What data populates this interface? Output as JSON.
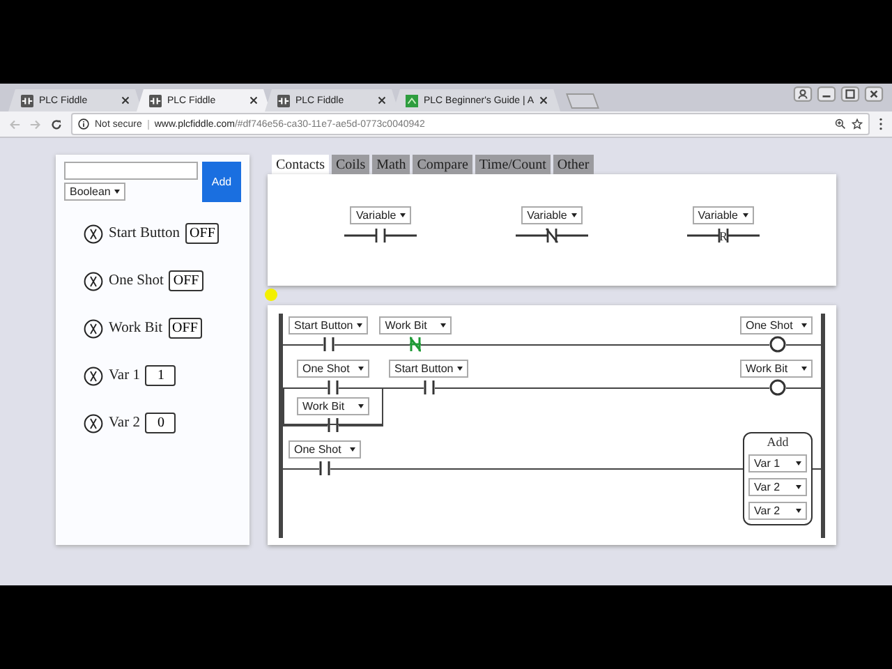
{
  "browser": {
    "tabs": [
      {
        "title": "PLC Fiddle",
        "selected": false,
        "kind": "fiddle"
      },
      {
        "title": "PLC Fiddle",
        "selected": true,
        "kind": "fiddle"
      },
      {
        "title": "PLC Fiddle",
        "selected": false,
        "kind": "fiddle"
      },
      {
        "title": "PLC Beginner's Guide | A",
        "selected": false,
        "kind": "guide"
      }
    ],
    "address_bar": {
      "security": "Not secure",
      "host": "www.plcfiddle.com",
      "path": "/#df746e56-ca30-11e7-ae5d-0773c0040942"
    }
  },
  "sidebar": {
    "type_dropdown": "Boolean",
    "add_button": "Add",
    "variables": [
      {
        "name": "Start Button",
        "value": "OFF"
      },
      {
        "name": "One Shot",
        "value": "OFF"
      },
      {
        "name": "Work Bit",
        "value": "OFF"
      },
      {
        "name": "Var 1",
        "value": "1"
      },
      {
        "name": "Var 2",
        "value": "0"
      }
    ]
  },
  "palette": {
    "tabs": [
      {
        "label": "Contacts",
        "selected": true
      },
      {
        "label": "Coils",
        "selected": false
      },
      {
        "label": "Math",
        "selected": false
      },
      {
        "label": "Compare",
        "selected": false
      },
      {
        "label": "Time/Count",
        "selected": false
      },
      {
        "label": "Other",
        "selected": false
      }
    ],
    "items": [
      {
        "variable": "Variable",
        "kind": "no"
      },
      {
        "variable": "Variable",
        "kind": "nc"
      },
      {
        "variable": "Variable",
        "kind": "rising",
        "symbol": "R"
      }
    ]
  },
  "ladder": {
    "rungs": [
      {
        "elements": [
          {
            "kind": "no",
            "variable": "Start Button",
            "active": false
          },
          {
            "kind": "nc",
            "variable": "Work Bit",
            "active": true
          }
        ],
        "output": {
          "kind": "coil",
          "variable": "One Shot"
        }
      },
      {
        "elements": [
          {
            "kind": "parallel",
            "branches": [
              {
                "kind": "no",
                "variable": "One Shot",
                "active": false
              },
              {
                "kind": "no",
                "variable": "Work Bit",
                "active": false
              }
            ]
          },
          {
            "kind": "no",
            "variable": "Start Button",
            "active": false
          }
        ],
        "output": {
          "kind": "coil",
          "variable": "Work Bit"
        }
      },
      {
        "elements": [
          {
            "kind": "no",
            "variable": "One Shot",
            "active": false
          }
        ],
        "output": {
          "kind": "add",
          "title": "Add",
          "operands": [
            "Var 1",
            "Var 2",
            "Var 2"
          ]
        }
      }
    ]
  }
}
